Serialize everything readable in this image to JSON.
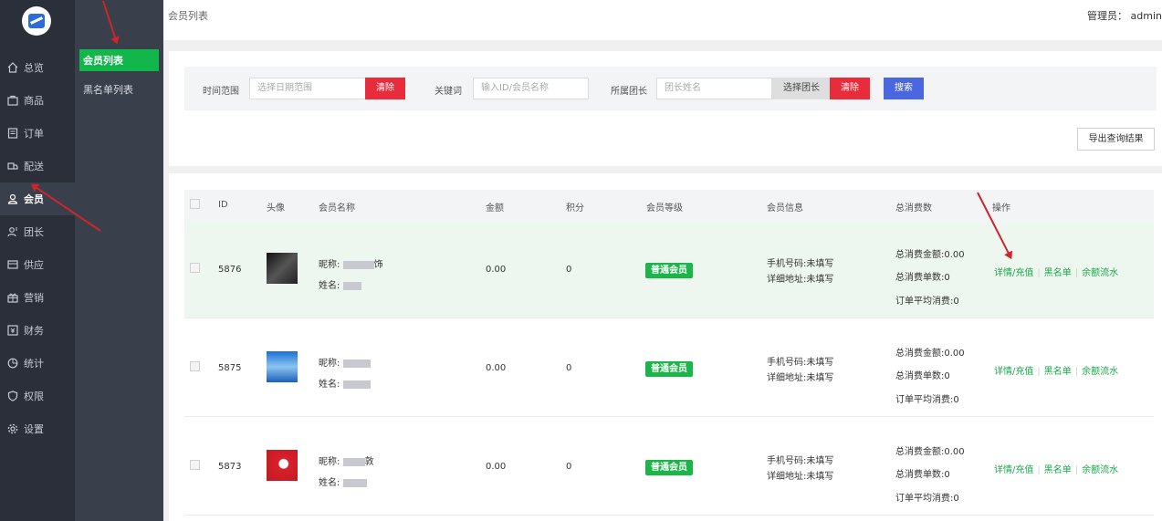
{
  "topbar": {
    "breadcrumb": "会员列表",
    "admin": "管理员： admin"
  },
  "nav": [
    {
      "label": "总览",
      "icon": "home-icon"
    },
    {
      "label": "商品",
      "icon": "goods-icon"
    },
    {
      "label": "订单",
      "icon": "order-icon"
    },
    {
      "label": "配送",
      "icon": "delivery-icon"
    },
    {
      "label": "会员",
      "icon": "user-icon"
    },
    {
      "label": "团长",
      "icon": "leader-icon"
    },
    {
      "label": "供应",
      "icon": "supply-icon"
    },
    {
      "label": "营销",
      "icon": "gift-icon"
    },
    {
      "label": "财务",
      "icon": "finance-icon"
    },
    {
      "label": "统计",
      "icon": "chart-icon"
    },
    {
      "label": "权限",
      "icon": "shield-icon"
    },
    {
      "label": "设置",
      "icon": "gear-icon"
    }
  ],
  "subnav": [
    {
      "label": "会员列表"
    },
    {
      "label": "黑名单列表"
    }
  ],
  "filter": {
    "time_label": "时间范围",
    "time_placeholder": "选择日期范围",
    "clear": "清除",
    "keyword_label": "关键词",
    "keyword_placeholder": "输入ID/会员名称",
    "leader_label": "所属团长",
    "leader_placeholder": "团长姓名",
    "select_leader": "选择团长",
    "search": "搜索",
    "export": "导出查询结果"
  },
  "table": {
    "headers": [
      "ID",
      "头像",
      "会员名称",
      "金额",
      "积分",
      "会员等级",
      "会员信息",
      "总消费数",
      "操作"
    ],
    "rows": [
      {
        "id": "5876",
        "nick_prefix": "昵称: ",
        "nick_visible": "饰",
        "name_prefix": "姓名: ",
        "amount": "0.00",
        "points": "0",
        "level": "普通会员",
        "phone": "手机号码:未填写",
        "address": "详细地址:未填写",
        "total_amount": "总消费金额:0.00",
        "total_orders": "总消费单数:0",
        "avg": "订单平均消费:0"
      },
      {
        "id": "5875",
        "nick_prefix": "昵称: ",
        "nick_visible": "",
        "name_prefix": "姓名: ",
        "amount": "0.00",
        "points": "0",
        "level": "普通会员",
        "phone": "手机号码:未填写",
        "address": "详细地址:未填写",
        "total_amount": "总消费金额:0.00",
        "total_orders": "总消费单数:0",
        "avg": "订单平均消费:0"
      },
      {
        "id": "5873",
        "nick_prefix": "昵称: ",
        "nick_visible": "敦",
        "name_prefix": "姓名: ",
        "amount": "0.00",
        "points": "0",
        "level": "普通会员",
        "phone": "手机号码:未填写",
        "address": "详细地址:未填写",
        "total_amount": "总消费金额:0.00",
        "total_orders": "总消费单数:0",
        "avg": "订单平均消费:0"
      }
    ],
    "ops": [
      "详情/充值",
      "黑名单",
      "余额流水"
    ]
  },
  "colors": {
    "accent_green": "#12b74c",
    "danger": "#e92c3c",
    "primary": "#4b67e0",
    "sidebar": "#2b2f3a"
  }
}
